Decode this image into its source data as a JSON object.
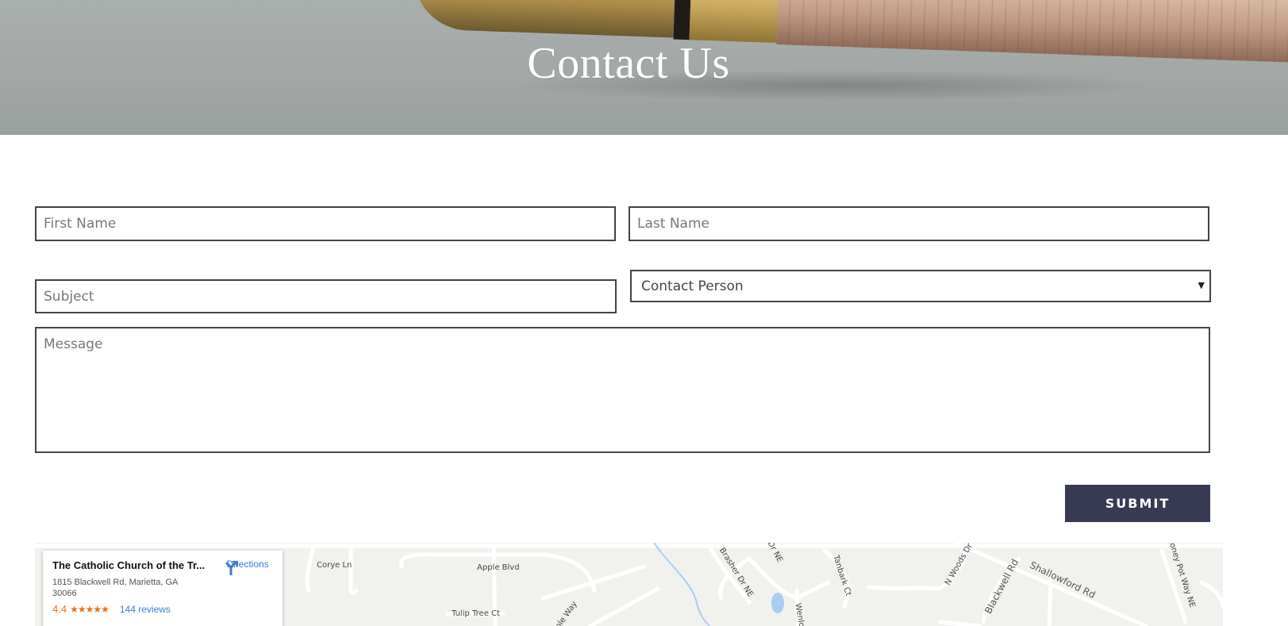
{
  "hero": {
    "title": "Contact Us"
  },
  "form": {
    "first_name_placeholder": "First Name",
    "last_name_placeholder": "Last Name",
    "subject_placeholder": "Subject",
    "contact_person_selected": "Contact Person",
    "message_placeholder": "Message",
    "submit_label": "SUBMIT"
  },
  "map": {
    "place_name": "The Catholic Church of the Tr...",
    "address": "1815 Blackwell Rd, Marietta, GA 30066",
    "rating": "4.4",
    "stars": "★★★★★",
    "reviews": "144 reviews",
    "directions_label": "Directions",
    "street_labels": {
      "corye_ln": "Corye Ln",
      "apple_blvd": "Apple Blvd",
      "tulip_tree_ct": "Tulip Tree Ct",
      "ple_way": "ple Way",
      "brasher_dr": "Brasher Dr NE",
      "dr_ne": "Dr NE",
      "tanbark_ct": "Tanbark Ct",
      "wenlo": "Wenlo",
      "woods_dr": "N Woods Dr",
      "blackwell_rd": "Blackwell Rd",
      "shallowford_rd": "Shallowford Rd",
      "honey_pot_way": "Honey Pot Way NE"
    }
  },
  "colors": {
    "submit_bg": "#373a52",
    "field_border": "#444444",
    "link": "#3a7bd5",
    "rating": "#e7711b"
  }
}
